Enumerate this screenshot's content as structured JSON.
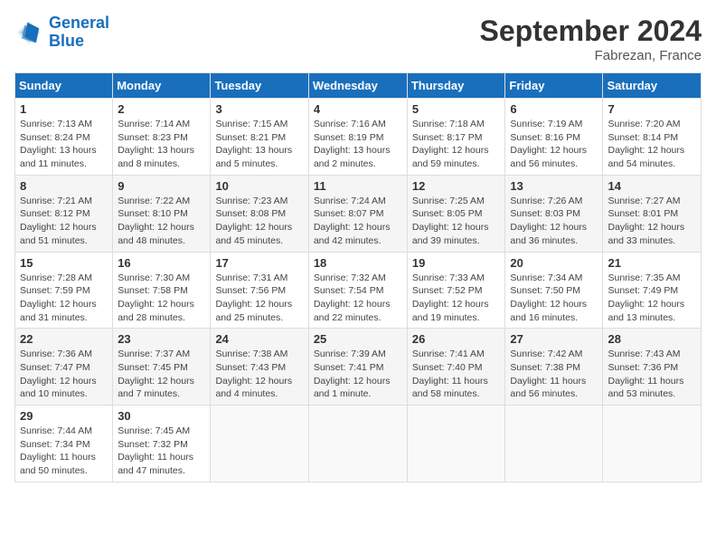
{
  "header": {
    "logo_line1": "General",
    "logo_line2": "Blue",
    "month_year": "September 2024",
    "location": "Fabrezan, France"
  },
  "weekdays": [
    "Sunday",
    "Monday",
    "Tuesday",
    "Wednesday",
    "Thursday",
    "Friday",
    "Saturday"
  ],
  "weeks": [
    [
      {
        "day": "1",
        "sunrise": "Sunrise: 7:13 AM",
        "sunset": "Sunset: 8:24 PM",
        "daylight": "Daylight: 13 hours and 11 minutes."
      },
      {
        "day": "2",
        "sunrise": "Sunrise: 7:14 AM",
        "sunset": "Sunset: 8:23 PM",
        "daylight": "Daylight: 13 hours and 8 minutes."
      },
      {
        "day": "3",
        "sunrise": "Sunrise: 7:15 AM",
        "sunset": "Sunset: 8:21 PM",
        "daylight": "Daylight: 13 hours and 5 minutes."
      },
      {
        "day": "4",
        "sunrise": "Sunrise: 7:16 AM",
        "sunset": "Sunset: 8:19 PM",
        "daylight": "Daylight: 13 hours and 2 minutes."
      },
      {
        "day": "5",
        "sunrise": "Sunrise: 7:18 AM",
        "sunset": "Sunset: 8:17 PM",
        "daylight": "Daylight: 12 hours and 59 minutes."
      },
      {
        "day": "6",
        "sunrise": "Sunrise: 7:19 AM",
        "sunset": "Sunset: 8:16 PM",
        "daylight": "Daylight: 12 hours and 56 minutes."
      },
      {
        "day": "7",
        "sunrise": "Sunrise: 7:20 AM",
        "sunset": "Sunset: 8:14 PM",
        "daylight": "Daylight: 12 hours and 54 minutes."
      }
    ],
    [
      {
        "day": "8",
        "sunrise": "Sunrise: 7:21 AM",
        "sunset": "Sunset: 8:12 PM",
        "daylight": "Daylight: 12 hours and 51 minutes."
      },
      {
        "day": "9",
        "sunrise": "Sunrise: 7:22 AM",
        "sunset": "Sunset: 8:10 PM",
        "daylight": "Daylight: 12 hours and 48 minutes."
      },
      {
        "day": "10",
        "sunrise": "Sunrise: 7:23 AM",
        "sunset": "Sunset: 8:08 PM",
        "daylight": "Daylight: 12 hours and 45 minutes."
      },
      {
        "day": "11",
        "sunrise": "Sunrise: 7:24 AM",
        "sunset": "Sunset: 8:07 PM",
        "daylight": "Daylight: 12 hours and 42 minutes."
      },
      {
        "day": "12",
        "sunrise": "Sunrise: 7:25 AM",
        "sunset": "Sunset: 8:05 PM",
        "daylight": "Daylight: 12 hours and 39 minutes."
      },
      {
        "day": "13",
        "sunrise": "Sunrise: 7:26 AM",
        "sunset": "Sunset: 8:03 PM",
        "daylight": "Daylight: 12 hours and 36 minutes."
      },
      {
        "day": "14",
        "sunrise": "Sunrise: 7:27 AM",
        "sunset": "Sunset: 8:01 PM",
        "daylight": "Daylight: 12 hours and 33 minutes."
      }
    ],
    [
      {
        "day": "15",
        "sunrise": "Sunrise: 7:28 AM",
        "sunset": "Sunset: 7:59 PM",
        "daylight": "Daylight: 12 hours and 31 minutes."
      },
      {
        "day": "16",
        "sunrise": "Sunrise: 7:30 AM",
        "sunset": "Sunset: 7:58 PM",
        "daylight": "Daylight: 12 hours and 28 minutes."
      },
      {
        "day": "17",
        "sunrise": "Sunrise: 7:31 AM",
        "sunset": "Sunset: 7:56 PM",
        "daylight": "Daylight: 12 hours and 25 minutes."
      },
      {
        "day": "18",
        "sunrise": "Sunrise: 7:32 AM",
        "sunset": "Sunset: 7:54 PM",
        "daylight": "Daylight: 12 hours and 22 minutes."
      },
      {
        "day": "19",
        "sunrise": "Sunrise: 7:33 AM",
        "sunset": "Sunset: 7:52 PM",
        "daylight": "Daylight: 12 hours and 19 minutes."
      },
      {
        "day": "20",
        "sunrise": "Sunrise: 7:34 AM",
        "sunset": "Sunset: 7:50 PM",
        "daylight": "Daylight: 12 hours and 16 minutes."
      },
      {
        "day": "21",
        "sunrise": "Sunrise: 7:35 AM",
        "sunset": "Sunset: 7:49 PM",
        "daylight": "Daylight: 12 hours and 13 minutes."
      }
    ],
    [
      {
        "day": "22",
        "sunrise": "Sunrise: 7:36 AM",
        "sunset": "Sunset: 7:47 PM",
        "daylight": "Daylight: 12 hours and 10 minutes."
      },
      {
        "day": "23",
        "sunrise": "Sunrise: 7:37 AM",
        "sunset": "Sunset: 7:45 PM",
        "daylight": "Daylight: 12 hours and 7 minutes."
      },
      {
        "day": "24",
        "sunrise": "Sunrise: 7:38 AM",
        "sunset": "Sunset: 7:43 PM",
        "daylight": "Daylight: 12 hours and 4 minutes."
      },
      {
        "day": "25",
        "sunrise": "Sunrise: 7:39 AM",
        "sunset": "Sunset: 7:41 PM",
        "daylight": "Daylight: 12 hours and 1 minute."
      },
      {
        "day": "26",
        "sunrise": "Sunrise: 7:41 AM",
        "sunset": "Sunset: 7:40 PM",
        "daylight": "Daylight: 11 hours and 58 minutes."
      },
      {
        "day": "27",
        "sunrise": "Sunrise: 7:42 AM",
        "sunset": "Sunset: 7:38 PM",
        "daylight": "Daylight: 11 hours and 56 minutes."
      },
      {
        "day": "28",
        "sunrise": "Sunrise: 7:43 AM",
        "sunset": "Sunset: 7:36 PM",
        "daylight": "Daylight: 11 hours and 53 minutes."
      }
    ],
    [
      {
        "day": "29",
        "sunrise": "Sunrise: 7:44 AM",
        "sunset": "Sunset: 7:34 PM",
        "daylight": "Daylight: 11 hours and 50 minutes."
      },
      {
        "day": "30",
        "sunrise": "Sunrise: 7:45 AM",
        "sunset": "Sunset: 7:32 PM",
        "daylight": "Daylight: 11 hours and 47 minutes."
      },
      null,
      null,
      null,
      null,
      null
    ]
  ]
}
